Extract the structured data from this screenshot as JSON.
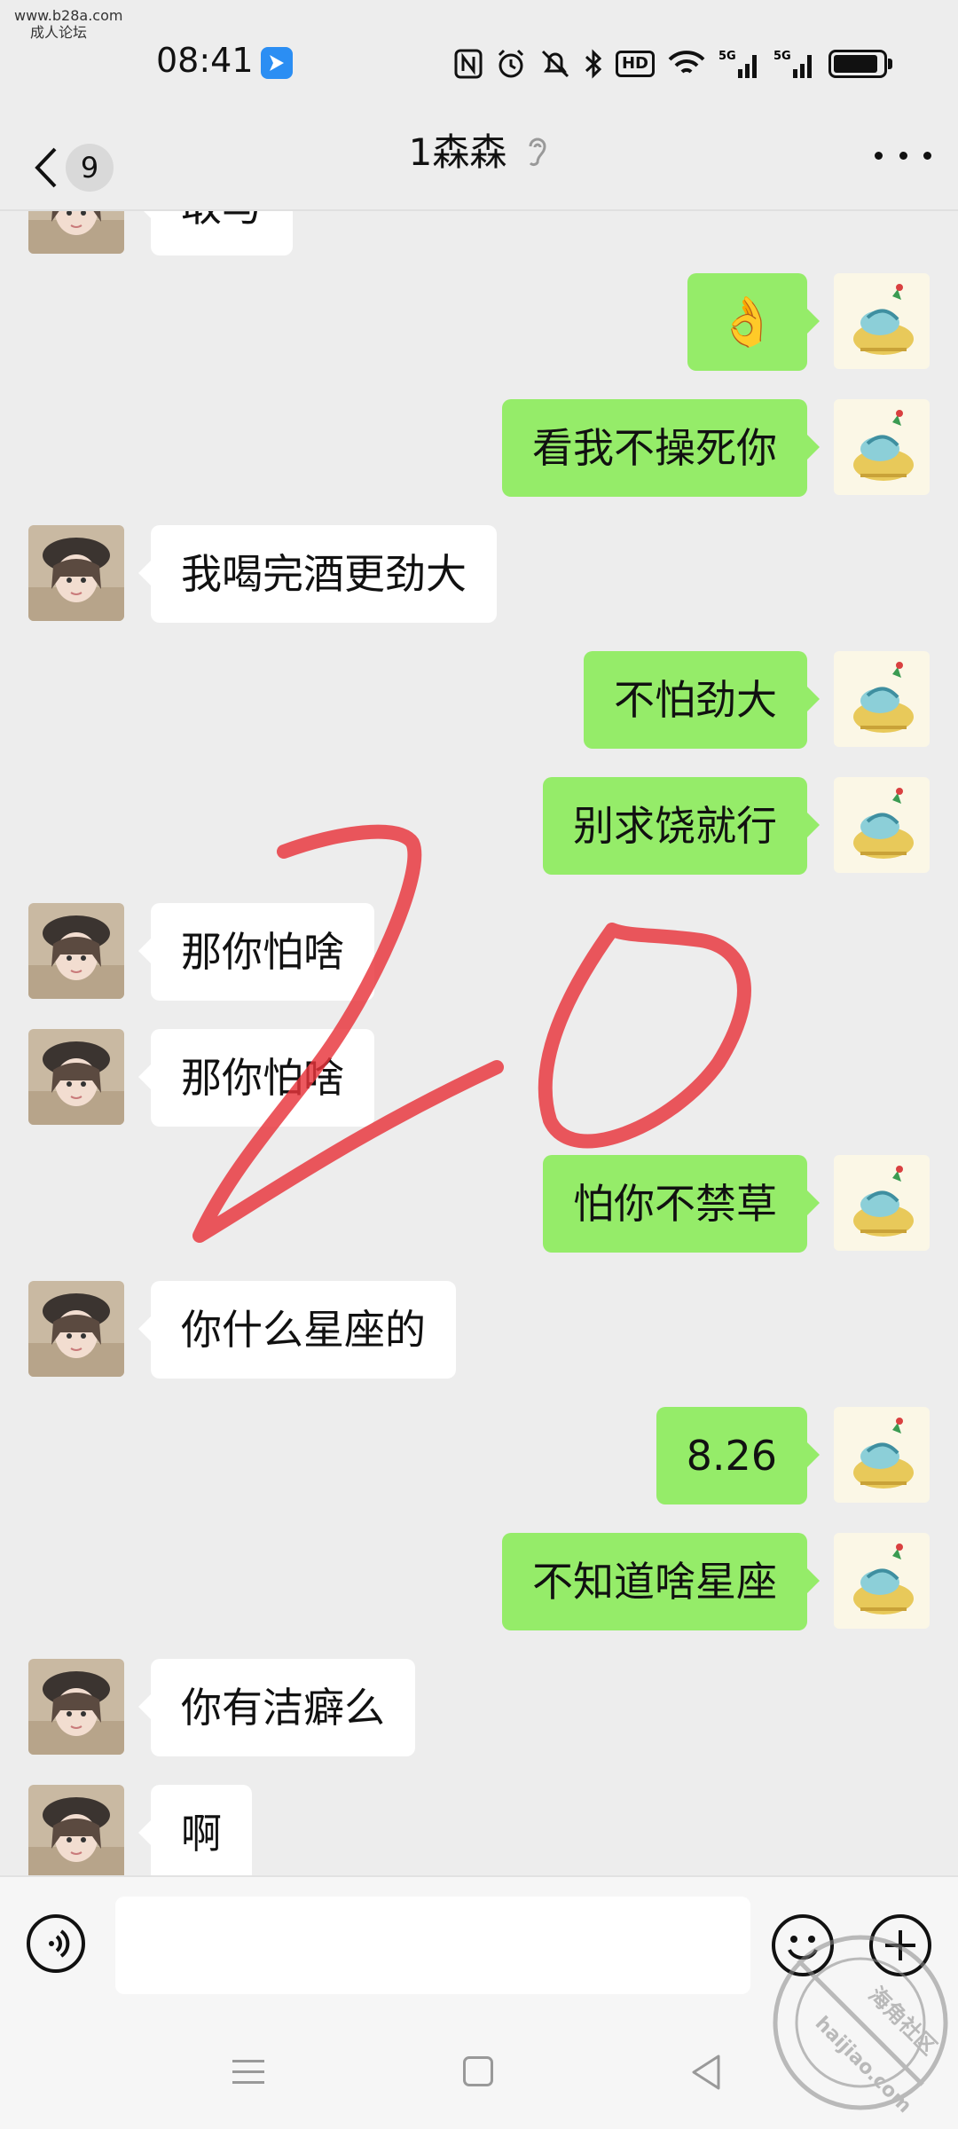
{
  "watermark_top": {
    "line1": "www.b28a.com",
    "line2": "成人论坛"
  },
  "statusbar": {
    "time": "08:41",
    "hd_label": "HD",
    "signal1_label": "5G",
    "signal2_label": "5G",
    "battery_level": 0.9,
    "icons": [
      "app-notification-icon",
      "nfc-icon",
      "alarm-icon",
      "mute-icon",
      "bluetooth-icon",
      "hd-icon",
      "wifi-icon",
      "signal-5g-icon",
      "signal-5g-icon",
      "battery-icon"
    ]
  },
  "header": {
    "back_count": "9",
    "title": "1森森",
    "more_icon": "more-icon",
    "ear_icon": "earpiece-icon"
  },
  "messages": [
    {
      "side": "left",
      "text": "取与"
    },
    {
      "side": "right",
      "text": "👌",
      "is_emoji": true
    },
    {
      "side": "right",
      "text": "看我不操死你"
    },
    {
      "side": "left",
      "text": "我喝完酒更劲大"
    },
    {
      "side": "right",
      "text": "不怕劲大"
    },
    {
      "side": "right",
      "text": "别求饶就行"
    },
    {
      "side": "left",
      "text": "那你怕啥"
    },
    {
      "side": "left",
      "text": "那你怕啥"
    },
    {
      "side": "right",
      "text": "怕你不禁草"
    },
    {
      "side": "left",
      "text": "你什么星座的"
    },
    {
      "side": "right",
      "text": "8.26"
    },
    {
      "side": "right",
      "text": "不知道啥星座"
    },
    {
      "side": "left",
      "text": "你有洁癖么"
    },
    {
      "side": "left",
      "text": "啊"
    }
  ],
  "scribble_text": "20",
  "input": {
    "placeholder": ""
  },
  "stamp": {
    "line1": "海角社区",
    "line2": "haijiao.com"
  },
  "colors": {
    "background": "#ededed",
    "bubble_self": "#95ec69",
    "bubble_other": "#ffffff",
    "scribble": "#e8333a"
  }
}
